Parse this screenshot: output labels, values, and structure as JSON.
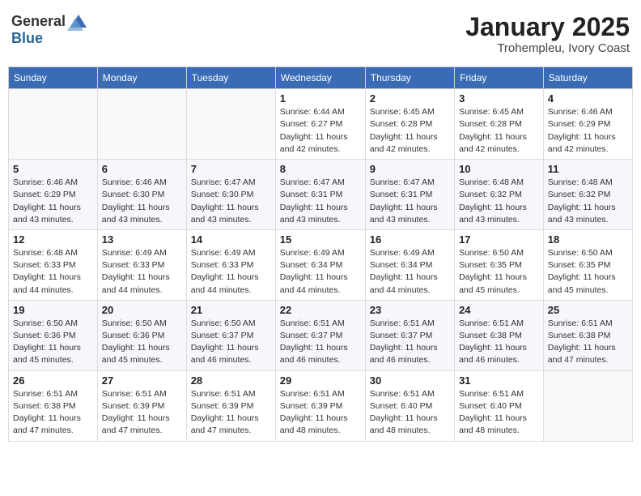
{
  "logo": {
    "general": "General",
    "blue": "Blue"
  },
  "title": "January 2025",
  "subtitle": "Trohempleu, Ivory Coast",
  "days_of_week": [
    "Sunday",
    "Monday",
    "Tuesday",
    "Wednesday",
    "Thursday",
    "Friday",
    "Saturday"
  ],
  "weeks": [
    [
      {
        "day": "",
        "info": ""
      },
      {
        "day": "",
        "info": ""
      },
      {
        "day": "",
        "info": ""
      },
      {
        "day": "1",
        "info": "Sunrise: 6:44 AM\nSunset: 6:27 PM\nDaylight: 11 hours\nand 42 minutes."
      },
      {
        "day": "2",
        "info": "Sunrise: 6:45 AM\nSunset: 6:28 PM\nDaylight: 11 hours\nand 42 minutes."
      },
      {
        "day": "3",
        "info": "Sunrise: 6:45 AM\nSunset: 6:28 PM\nDaylight: 11 hours\nand 42 minutes."
      },
      {
        "day": "4",
        "info": "Sunrise: 6:46 AM\nSunset: 6:29 PM\nDaylight: 11 hours\nand 42 minutes."
      }
    ],
    [
      {
        "day": "5",
        "info": "Sunrise: 6:46 AM\nSunset: 6:29 PM\nDaylight: 11 hours\nand 43 minutes."
      },
      {
        "day": "6",
        "info": "Sunrise: 6:46 AM\nSunset: 6:30 PM\nDaylight: 11 hours\nand 43 minutes."
      },
      {
        "day": "7",
        "info": "Sunrise: 6:47 AM\nSunset: 6:30 PM\nDaylight: 11 hours\nand 43 minutes."
      },
      {
        "day": "8",
        "info": "Sunrise: 6:47 AM\nSunset: 6:31 PM\nDaylight: 11 hours\nand 43 minutes."
      },
      {
        "day": "9",
        "info": "Sunrise: 6:47 AM\nSunset: 6:31 PM\nDaylight: 11 hours\nand 43 minutes."
      },
      {
        "day": "10",
        "info": "Sunrise: 6:48 AM\nSunset: 6:32 PM\nDaylight: 11 hours\nand 43 minutes."
      },
      {
        "day": "11",
        "info": "Sunrise: 6:48 AM\nSunset: 6:32 PM\nDaylight: 11 hours\nand 43 minutes."
      }
    ],
    [
      {
        "day": "12",
        "info": "Sunrise: 6:48 AM\nSunset: 6:33 PM\nDaylight: 11 hours\nand 44 minutes."
      },
      {
        "day": "13",
        "info": "Sunrise: 6:49 AM\nSunset: 6:33 PM\nDaylight: 11 hours\nand 44 minutes."
      },
      {
        "day": "14",
        "info": "Sunrise: 6:49 AM\nSunset: 6:33 PM\nDaylight: 11 hours\nand 44 minutes."
      },
      {
        "day": "15",
        "info": "Sunrise: 6:49 AM\nSunset: 6:34 PM\nDaylight: 11 hours\nand 44 minutes."
      },
      {
        "day": "16",
        "info": "Sunrise: 6:49 AM\nSunset: 6:34 PM\nDaylight: 11 hours\nand 44 minutes."
      },
      {
        "day": "17",
        "info": "Sunrise: 6:50 AM\nSunset: 6:35 PM\nDaylight: 11 hours\nand 45 minutes."
      },
      {
        "day": "18",
        "info": "Sunrise: 6:50 AM\nSunset: 6:35 PM\nDaylight: 11 hours\nand 45 minutes."
      }
    ],
    [
      {
        "day": "19",
        "info": "Sunrise: 6:50 AM\nSunset: 6:36 PM\nDaylight: 11 hours\nand 45 minutes."
      },
      {
        "day": "20",
        "info": "Sunrise: 6:50 AM\nSunset: 6:36 PM\nDaylight: 11 hours\nand 45 minutes."
      },
      {
        "day": "21",
        "info": "Sunrise: 6:50 AM\nSunset: 6:37 PM\nDaylight: 11 hours\nand 46 minutes."
      },
      {
        "day": "22",
        "info": "Sunrise: 6:51 AM\nSunset: 6:37 PM\nDaylight: 11 hours\nand 46 minutes."
      },
      {
        "day": "23",
        "info": "Sunrise: 6:51 AM\nSunset: 6:37 PM\nDaylight: 11 hours\nand 46 minutes."
      },
      {
        "day": "24",
        "info": "Sunrise: 6:51 AM\nSunset: 6:38 PM\nDaylight: 11 hours\nand 46 minutes."
      },
      {
        "day": "25",
        "info": "Sunrise: 6:51 AM\nSunset: 6:38 PM\nDaylight: 11 hours\nand 47 minutes."
      }
    ],
    [
      {
        "day": "26",
        "info": "Sunrise: 6:51 AM\nSunset: 6:38 PM\nDaylight: 11 hours\nand 47 minutes."
      },
      {
        "day": "27",
        "info": "Sunrise: 6:51 AM\nSunset: 6:39 PM\nDaylight: 11 hours\nand 47 minutes."
      },
      {
        "day": "28",
        "info": "Sunrise: 6:51 AM\nSunset: 6:39 PM\nDaylight: 11 hours\nand 47 minutes."
      },
      {
        "day": "29",
        "info": "Sunrise: 6:51 AM\nSunset: 6:39 PM\nDaylight: 11 hours\nand 48 minutes."
      },
      {
        "day": "30",
        "info": "Sunrise: 6:51 AM\nSunset: 6:40 PM\nDaylight: 11 hours\nand 48 minutes."
      },
      {
        "day": "31",
        "info": "Sunrise: 6:51 AM\nSunset: 6:40 PM\nDaylight: 11 hours\nand 48 minutes."
      },
      {
        "day": "",
        "info": ""
      }
    ]
  ]
}
